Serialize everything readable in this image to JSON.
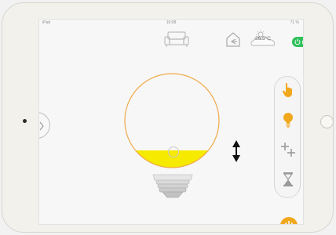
{
  "status_bar": {
    "carrier": "iPad",
    "time": "10:08",
    "battery": "71 %"
  },
  "header": {
    "temperature": "26.5°C",
    "power_toggle": "on"
  },
  "side_panel": {
    "icons": [
      "hand-pointer-icon",
      "lightbulb-icon",
      "plus-cross-icon",
      "hourglass-icon"
    ]
  },
  "bulb": {
    "fill_level": 0.3,
    "fill_color": "#f5ea00"
  },
  "colors": {
    "accent": "#f2a81c",
    "toggle": "#2ec05a",
    "bulb_outline": "#f0a848"
  }
}
